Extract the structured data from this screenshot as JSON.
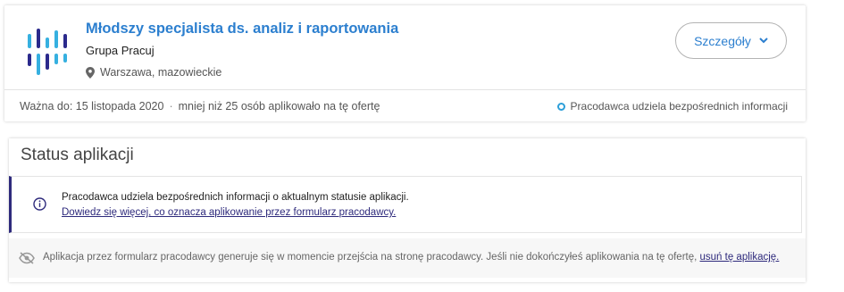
{
  "job": {
    "title": "Młodszy specjalista ds. analiz i raportowania",
    "company": "Grupa Pracuj",
    "location": "Warszawa, mazowieckie",
    "details_label": "Szczegóły",
    "valid_until": "Ważna do: 15 listopada 2020",
    "separator": "·",
    "applicants": "mniej niż 25 osób aplikowało na tę ofertę",
    "direct_info": "Pracodawca udziela bezpośrednich informacji"
  },
  "status": {
    "title": "Status aplikacji",
    "info_text": "Pracodawca udziela bezpośrednich informacji o aktualnym statusie aplikacji.",
    "info_link": "Dowiedz się więcej, co oznacza aplikowanie przez formularz pracodawcy.",
    "gen_text": "Aplikacja przez formularz pracodawcy generuje się w momencie przejścia na stronę pracodawcy. Jeśli nie dokończyłeś aplikowania na tę ofertę, ",
    "gen_link": "usuń tę aplikację."
  },
  "colors": {
    "link_blue": "#2c7fcf",
    "navy": "#2e2a7c",
    "logo_navy": "#2b2a8c",
    "logo_light": "#36b0e0"
  },
  "icons": [
    "company-logo",
    "location-pin-icon",
    "chevron-down-icon",
    "info-icon",
    "eye-off-icon"
  ]
}
